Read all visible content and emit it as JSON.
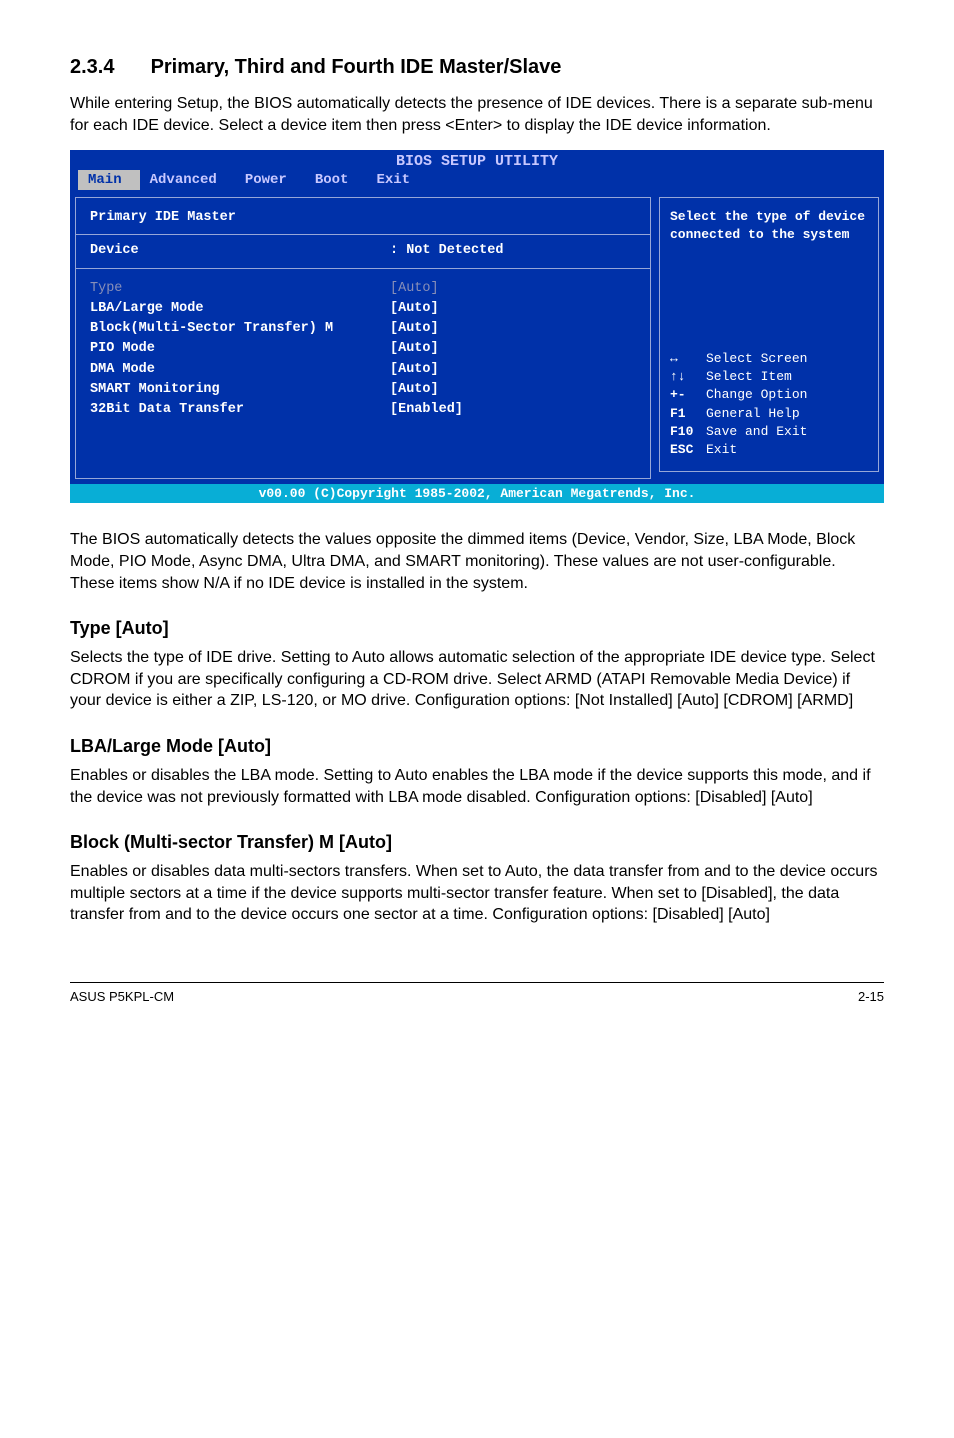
{
  "section": {
    "number": "2.3.4",
    "title": "Primary, Third and Fourth IDE Master/Slave",
    "intro": "While entering Setup, the BIOS automatically detects the presence of IDE devices. There is a separate sub-menu for each IDE device. Select a device item then press <Enter> to display the IDE device information."
  },
  "bios": {
    "header": "BIOS SETUP UTILITY",
    "tabs": [
      "Main",
      "Advanced",
      "Power",
      "Boot",
      "Exit"
    ],
    "active_tab": "Main",
    "panel_title": "Primary IDE Master",
    "device_label": "Device",
    "device_value": ": Not Detected",
    "items": [
      {
        "label": "Type",
        "value": "[Auto]",
        "selected": true
      },
      {
        "label": "LBA/Large Mode",
        "value": "[Auto]"
      },
      {
        "label": "Block(Multi-Sector Transfer) M",
        "value": "[Auto]"
      },
      {
        "label": "PIO Mode",
        "value": "[Auto]"
      },
      {
        "label": "DMA Mode",
        "value": "[Auto]"
      },
      {
        "label": "SMART Monitoring",
        "value": "[Auto]"
      },
      {
        "label": "32Bit Data Transfer",
        "value": "[Enabled]"
      }
    ],
    "help_text": "Select the type of device connected to the system",
    "hints": [
      {
        "key": "↔",
        "desc": "Select Screen"
      },
      {
        "key": "↑↓",
        "desc": "Select Item"
      },
      {
        "key": "+-",
        "desc": "Change Option"
      },
      {
        "key": "F1",
        "desc": "General Help"
      },
      {
        "key": "F10",
        "desc": "Save and Exit"
      },
      {
        "key": "ESC",
        "desc": "Exit"
      }
    ],
    "footer": "v00.00 (C)Copyright 1985-2002, American Megatrends, Inc."
  },
  "after_bios": "The BIOS automatically detects the values opposite the dimmed items (Device, Vendor, Size, LBA Mode, Block Mode, PIO Mode, Async DMA, Ultra DMA, and SMART monitoring). These values are not user-configurable. These items show N/A if no IDE device is installed in the system.",
  "subs": {
    "type": {
      "title": "Type [Auto]",
      "body": "Selects the type of IDE drive. Setting to Auto allows automatic selection of the appropriate IDE device type. Select CDROM if you are specifically configuring a CD-ROM drive. Select ARMD (ATAPI Removable Media Device) if your device is either a ZIP, LS-120, or MO drive. Configuration options: [Not Installed] [Auto] [CDROM] [ARMD]"
    },
    "lba": {
      "title": "LBA/Large Mode [Auto]",
      "body": "Enables or disables the LBA mode. Setting to Auto enables the LBA mode if the device supports this mode, and if the device was not previously formatted with LBA mode disabled. Configuration options: [Disabled] [Auto]"
    },
    "block": {
      "title": "Block (Multi-sector Transfer) M [Auto]",
      "body": "Enables or disables data multi-sectors transfers. When set to Auto, the data transfer from and to the device occurs multiple sectors at a time if the device supports multi-sector transfer feature. When set to [Disabled], the data transfer from and to the device occurs one sector at a time. Configuration options: [Disabled] [Auto]"
    }
  },
  "footer": {
    "left": "ASUS P5KPL-CM",
    "right": "2-15"
  }
}
